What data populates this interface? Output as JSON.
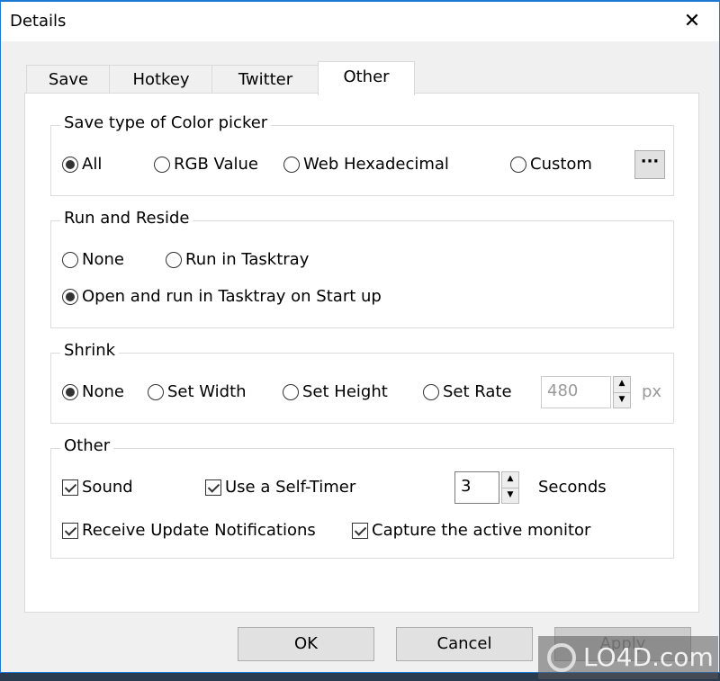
{
  "window": {
    "title": "Details",
    "close_glyph": "✕"
  },
  "tabs": [
    {
      "label": "Save",
      "active": false
    },
    {
      "label": "Hotkey",
      "active": false
    },
    {
      "label": "Twitter",
      "active": false
    },
    {
      "label": "Other",
      "active": true
    }
  ],
  "color_picker": {
    "legend": "Save type of Color picker",
    "options": [
      {
        "label": "All",
        "selected": true
      },
      {
        "label": "RGB Value",
        "selected": false
      },
      {
        "label": "Web Hexadecimal",
        "selected": false
      },
      {
        "label": "Custom",
        "selected": false
      }
    ],
    "more_button": "···"
  },
  "run_reside": {
    "legend": "Run and Reside",
    "options": [
      {
        "label": "None",
        "selected": false
      },
      {
        "label": "Run in Tasktray",
        "selected": false
      },
      {
        "label": "Open and run in Tasktray on Start up",
        "selected": true
      }
    ]
  },
  "shrink": {
    "legend": "Shrink",
    "options": [
      {
        "label": "None",
        "selected": true
      },
      {
        "label": "Set Width",
        "selected": false
      },
      {
        "label": "Set Height",
        "selected": false
      },
      {
        "label": "Set Rate",
        "selected": false
      }
    ],
    "value": "480",
    "unit": "px"
  },
  "other": {
    "legend": "Other",
    "sound": {
      "label": "Sound",
      "checked": true
    },
    "self_timer": {
      "label": "Use a Self-Timer",
      "checked": true
    },
    "timer_value": "3",
    "timer_unit": "Seconds",
    "updates": {
      "label": "Receive Update Notifications",
      "checked": true
    },
    "active_monitor": {
      "label": "Capture the active monitor",
      "checked": true
    }
  },
  "buttons": {
    "ok": "OK",
    "cancel": "Cancel",
    "apply": "Apply"
  },
  "watermark": "LO4D.com"
}
